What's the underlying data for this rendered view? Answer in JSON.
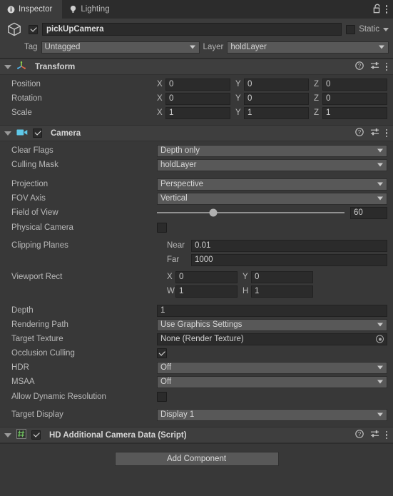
{
  "window": {
    "tabs": [
      {
        "label": "Inspector",
        "icon": "info-icon",
        "active": true
      },
      {
        "label": "Lighting",
        "icon": "lightbulb-icon",
        "active": false
      }
    ],
    "lock_icon": "lock-open-icon",
    "menu_icon": "kebab-menu-icon"
  },
  "gameobject": {
    "icon": "cube-icon",
    "enabled": true,
    "name": "pickUpCamera",
    "static_label": "Static",
    "static_checked": false,
    "tag_label": "Tag",
    "tag_value": "Untagged",
    "layer_label": "Layer",
    "layer_value": "holdLayer"
  },
  "components": [
    {
      "title": "Transform",
      "icon": "transform-axis-icon",
      "has_toggle": false,
      "expanded": true
    },
    {
      "title": "Camera",
      "icon": "camera-icon",
      "has_toggle": true,
      "enabled": true,
      "expanded": true
    },
    {
      "title": "HD Additional Camera Data (Script)",
      "icon": "script-hash-icon",
      "has_toggle": true,
      "enabled": true,
      "expanded": true
    }
  ],
  "transform": {
    "rows": [
      {
        "label": "Position",
        "x": "0",
        "y": "0",
        "z": "0"
      },
      {
        "label": "Rotation",
        "x": "0",
        "y": "0",
        "z": "0"
      },
      {
        "label": "Scale",
        "x": "1",
        "y": "1",
        "z": "1"
      }
    ],
    "axis_labels": {
      "x": "X",
      "y": "Y",
      "z": "Z"
    }
  },
  "camera": {
    "clear_flags": {
      "label": "Clear Flags",
      "value": "Depth only"
    },
    "culling_mask": {
      "label": "Culling Mask",
      "value": "holdLayer"
    },
    "projection": {
      "label": "Projection",
      "value": "Perspective"
    },
    "fov_axis": {
      "label": "FOV Axis",
      "value": "Vertical"
    },
    "field_of_view": {
      "label": "Field of View",
      "value": "60",
      "slider_percent": 30
    },
    "physical_camera": {
      "label": "Physical Camera",
      "checked": false
    },
    "clipping_planes": {
      "label": "Clipping Planes",
      "near_label": "Near",
      "near_value": "0.01",
      "far_label": "Far",
      "far_value": "1000"
    },
    "viewport_rect": {
      "label": "Viewport Rect",
      "x_label": "X",
      "x_value": "0",
      "y_label": "Y",
      "y_value": "0",
      "w_label": "W",
      "w_value": "1",
      "h_label": "H",
      "h_value": "1"
    },
    "depth": {
      "label": "Depth",
      "value": "1"
    },
    "rendering_path": {
      "label": "Rendering Path",
      "value": "Use Graphics Settings"
    },
    "target_texture": {
      "label": "Target Texture",
      "value": "None (Render Texture)",
      "picker_icon": "object-picker-icon"
    },
    "occlusion_culling": {
      "label": "Occlusion Culling",
      "checked": true
    },
    "hdr": {
      "label": "HDR",
      "value": "Off"
    },
    "msaa": {
      "label": "MSAA",
      "value": "Off"
    },
    "allow_dynamic_resolution": {
      "label": "Allow Dynamic Resolution",
      "checked": false
    },
    "target_display": {
      "label": "Target Display",
      "value": "Display 1"
    }
  },
  "footer": {
    "add_component_label": "Add Component"
  },
  "icons": {
    "help": "help-icon",
    "preset": "preset-settings-icon",
    "kebab": "kebab-menu-icon"
  },
  "colors": {
    "background": "#383838",
    "panel": "#3c3c3c",
    "tabbar": "#2c2c2c",
    "field": "#2b2b2b",
    "dropdown": "#585858",
    "camera_icon": "#5fc8e8",
    "script_icon": "#6fbf5f"
  }
}
